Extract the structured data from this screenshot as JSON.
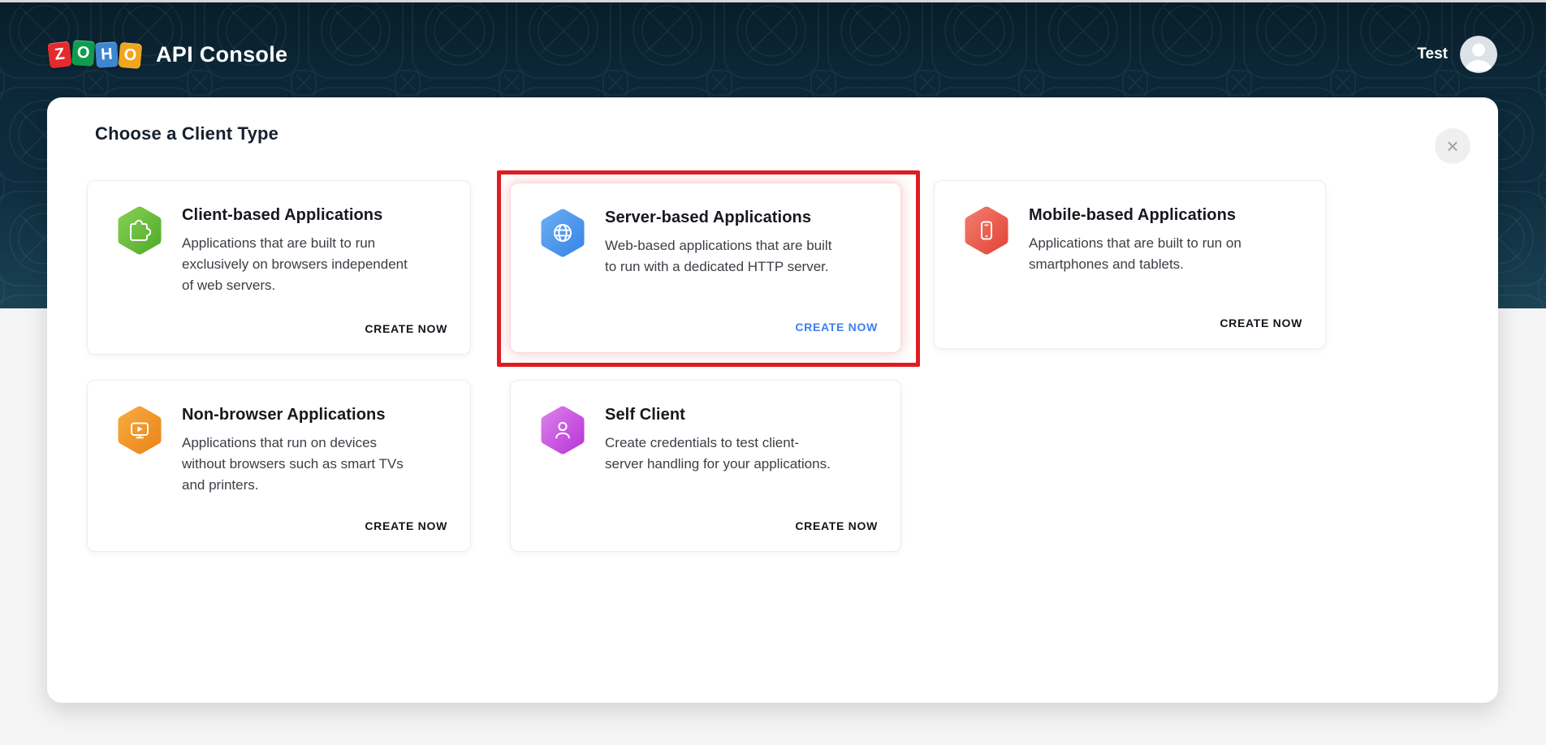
{
  "header": {
    "logo_tiles": [
      {
        "letter": "Z",
        "color": "#e42a2d"
      },
      {
        "letter": "O",
        "color": "#0e9d4e"
      },
      {
        "letter": "H",
        "color": "#3e86cf"
      },
      {
        "letter": "O",
        "color": "#efa51f"
      }
    ],
    "app_title": "API Console",
    "user_name": "Test"
  },
  "modal": {
    "title": "Choose a Client Type",
    "close_icon": "×",
    "cards": [
      {
        "title": "Client-based Applications",
        "description": "Applications that are built to run exclusively on browsers independent of web servers.",
        "cta": "CREATE NOW",
        "icon": "puzzle-icon",
        "accent_from": "#83cd53",
        "accent_to": "#54ad2a",
        "highlighted": false
      },
      {
        "title": "Server-based Applications",
        "description": "Web-based applications that are built to run with a dedicated HTTP server.",
        "cta": "CREATE NOW",
        "icon": "globe-icon",
        "accent_from": "#67abf1",
        "accent_to": "#3a87e8",
        "cta_color": "#3f7ef0",
        "highlighted": true
      },
      {
        "title": "Mobile-based Applications",
        "description": "Applications that are built to run on smartphones and tablets.",
        "cta": "CREATE NOW",
        "icon": "smartphone-icon",
        "accent_from": "#f1796a",
        "accent_to": "#e3483a",
        "highlighted": false
      },
      {
        "title": "Non-browser Applications",
        "description": "Applications that run on devices without browsers such as smart TVs and printers.",
        "cta": "CREATE NOW",
        "icon": "monitor-icon",
        "accent_from": "#f6a93c",
        "accent_to": "#ec861c",
        "highlighted": false
      },
      {
        "title": "Self Client",
        "description": "Create credentials to test client-server handling for your applications.",
        "cta": "CREATE NOW",
        "icon": "person-icon",
        "accent_from": "#d97cea",
        "accent_to": "#ba3ad8",
        "highlighted": false
      }
    ],
    "annotation": {
      "color": "#e01b22",
      "target": "Server-based Applications"
    }
  },
  "colors": {
    "header_bg": "#0c2838",
    "page_bg": "#f5f5f6",
    "cta_link_blue": "#3f7ef0",
    "annotation_red": "#e01b22"
  }
}
